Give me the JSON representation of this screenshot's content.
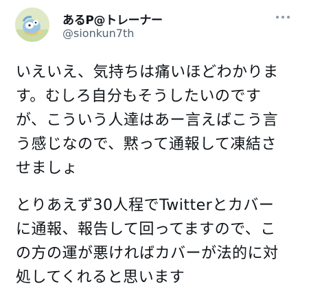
{
  "author": {
    "display_name": "あるP@トレーナー",
    "handle": "@sionkun7th",
    "avatar_icon": "mascot-avatar-icon"
  },
  "more_icon": "more-dots-icon",
  "body": {
    "paragraph1": [
      "いえいえ、気持ちは痛いほどわかりま",
      "す。むしろ自分もそうしたいのです",
      "が、こういう人達はあー言えばこう言",
      "う感じなので、黙って通報して凍結さ",
      "せましょ"
    ],
    "paragraph2": [
      "とりあえず30人程でTwitterとカバー",
      "に通報、報告して回ってますので、こ",
      "の方の運が悪ければカバーが法的に対",
      "処してくれると思います"
    ]
  },
  "colors": {
    "text": "#0f1419",
    "secondary": "#536471",
    "avatar_bg": "#dfe9c7"
  }
}
